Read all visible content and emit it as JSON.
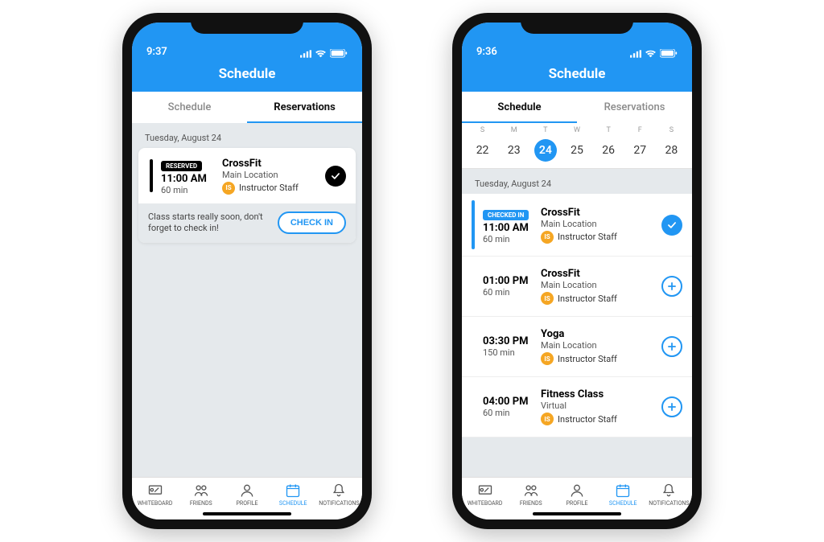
{
  "status": {
    "time_left": "9:37",
    "time_right": "9:36"
  },
  "header": {
    "title": "Schedule"
  },
  "tabs": {
    "schedule": "Schedule",
    "reservations": "Reservations"
  },
  "date_label": "Tuesday, August 24",
  "week": {
    "dow": [
      "S",
      "M",
      "T",
      "W",
      "T",
      "F",
      "S"
    ],
    "days": [
      "22",
      "23",
      "24",
      "25",
      "26",
      "27",
      "28"
    ],
    "active_index": 2
  },
  "reservation": {
    "badge": "RESERVED",
    "time": "11:00 AM",
    "duration": "60 min",
    "class": "CrossFit",
    "location": "Main Location",
    "instructor": "Instructor Staff",
    "instructor_init": "IS",
    "reminder": "Class starts really soon, don't forget to check in!",
    "checkin_label": "CHECK IN"
  },
  "schedule_items": [
    {
      "badge": "CHECKED IN",
      "time": "11:00 AM",
      "duration": "60 min",
      "class": "CrossFit",
      "location": "Main Location",
      "instructor": "Instructor Staff",
      "instructor_init": "IS",
      "status": "checked"
    },
    {
      "badge": "",
      "time": "01:00 PM",
      "duration": "60 min",
      "class": "CrossFit",
      "location": "Main Location",
      "instructor": "Instructor Staff",
      "instructor_init": "IS",
      "status": "add"
    },
    {
      "badge": "",
      "time": "03:30 PM",
      "duration": "150 min",
      "class": "Yoga",
      "location": "Main Location",
      "instructor": "Instructor Staff",
      "instructor_init": "IS",
      "status": "add"
    },
    {
      "badge": "",
      "time": "04:00 PM",
      "duration": "60 min",
      "class": "Fitness Class",
      "location": "Virtual",
      "instructor": "Instructor Staff",
      "instructor_init": "IS",
      "status": "add"
    }
  ],
  "bottom_tabs": {
    "whiteboard": "WHITEBOARD",
    "friends": "FRIENDS",
    "profile": "PROFILE",
    "schedule": "SCHEDULE",
    "notifications": "NOTIFICATIONS"
  }
}
